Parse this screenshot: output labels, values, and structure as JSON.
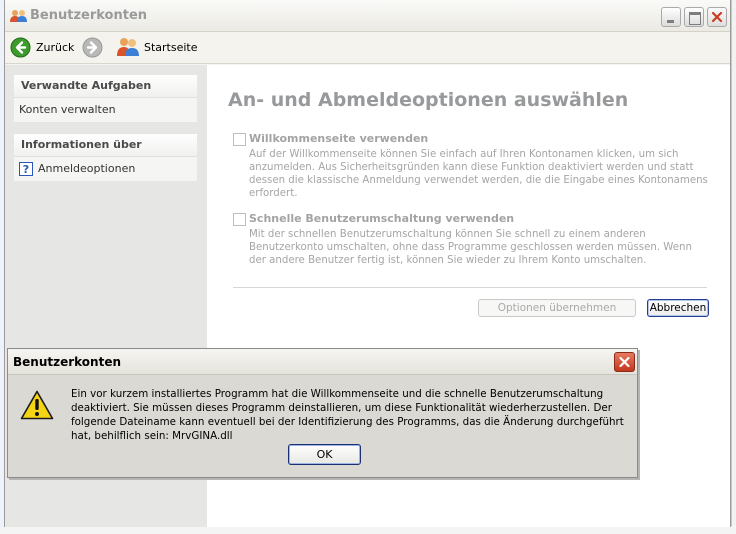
{
  "window": {
    "title": "Benutzerkonten"
  },
  "navbar": {
    "back_label": "Zurück",
    "home_label": "Startseite"
  },
  "taskpane": {
    "related_tasks": {
      "header": "Verwandte Aufgaben",
      "items": [
        "Konten verwalten"
      ]
    },
    "info": {
      "header": "Informationen über",
      "items": [
        "Anmeldeoptionen"
      ]
    }
  },
  "main": {
    "title": "An- und Abmeldeoptionen auswählen",
    "options": [
      {
        "label": "Willkommenseite verwenden",
        "checked": false,
        "description": "Auf der Willkommenseite können Sie einfach auf Ihren Kontonamen klicken, um sich anzumelden. Aus Sicherheitsgründen kann diese Funktion deaktiviert werden und statt dessen die klassische Anmeldung verwendet werden, die die Eingabe eines Kontonamens erfordert."
      },
      {
        "label": "Schnelle Benutzerumschaltung verwenden",
        "checked": false,
        "description": "Mit der schnellen Benutzerumschaltung können Sie schnell zu einem anderen Benutzerkonto umschalten, ohne dass Programme geschlossen werden müssen. Wenn der andere Benutzer fertig ist, können Sie wieder zu Ihrem Konto umschalten."
      }
    ],
    "apply_label": "Optionen übernehmen",
    "cancel_label": "Abbrechen"
  },
  "dialog": {
    "title": "Benutzerkonten",
    "message": "Ein vor kurzem installiertes Programm hat die Willkommenseite und die schnelle Benutzerumschaltung deaktiviert. Sie müssen dieses Programm deinstallieren, um diese Funktionalität wiederherzustellen. Der folgende Dateiname kann eventuell bei der Identifizierung des Programms, das die Änderung durchgeführt hat, behilflich sein: MrvGINA.dll",
    "ok_label": "OK"
  },
  "icons": {
    "app": "user-accounts-icon",
    "back": "back-arrow-icon",
    "forward": "forward-arrow-icon",
    "home": "user-accounts-icon",
    "help": "help-icon",
    "warning": "warning-icon",
    "close": "close-icon"
  },
  "colors": {
    "accent_green": "#3a9a2c",
    "dialog_close_red": "#c2381c",
    "warning_yellow": "#f5d414"
  }
}
